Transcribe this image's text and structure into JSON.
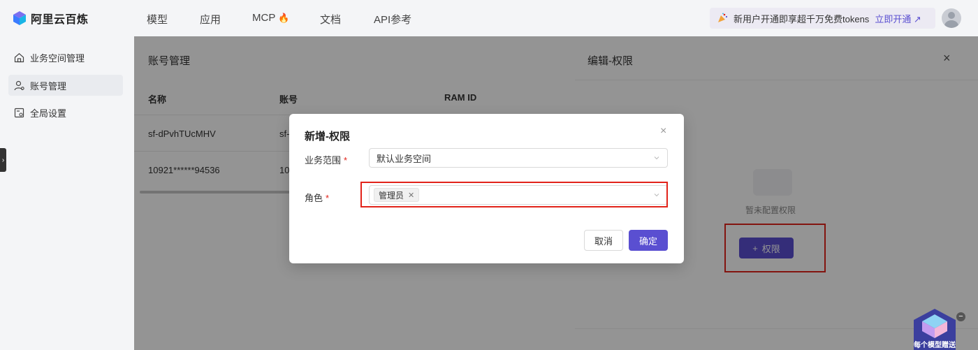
{
  "brand": {
    "name": "阿里云百炼"
  },
  "nav": {
    "items": [
      "模型",
      "应用",
      "MCP",
      "文档",
      "API参考"
    ],
    "mcp_emoji": "🔥"
  },
  "promo": {
    "text": "新用户开通即享超千万免费tokens",
    "link": "立即开通 ↗"
  },
  "sidebar": {
    "items": [
      {
        "label": "业务空间管理",
        "icon": "home-icon"
      },
      {
        "label": "账号管理",
        "icon": "user-icon"
      },
      {
        "label": "全局设置",
        "icon": "settings-icon"
      }
    ],
    "collapse_glyph": "›"
  },
  "page": {
    "title": "账号管理",
    "columns": [
      "名称",
      "账号",
      "RAM ID"
    ],
    "rows": [
      [
        "sf-dPvhTUcMHV",
        "sf-",
        ""
      ],
      [
        "10921******94536",
        "10",
        ""
      ]
    ]
  },
  "drawer": {
    "title": "编辑-权限",
    "close": "×",
    "empty_text": "暂未配置权限",
    "add_button": "权限",
    "add_icon": "+"
  },
  "modal": {
    "title": "新增-权限",
    "close": "×",
    "fields": {
      "scope_label": "业务范围",
      "scope_value": "默认业务空间",
      "role_label": "角色",
      "role_tag": "管理员",
      "required_mark": "*"
    },
    "cancel": "取消",
    "confirm": "确定"
  },
  "float_widget": {
    "label": "每个模型赠送",
    "minimize": "−"
  },
  "colors": {
    "accent": "#5a4fd1",
    "highlight": "#e2231a"
  }
}
